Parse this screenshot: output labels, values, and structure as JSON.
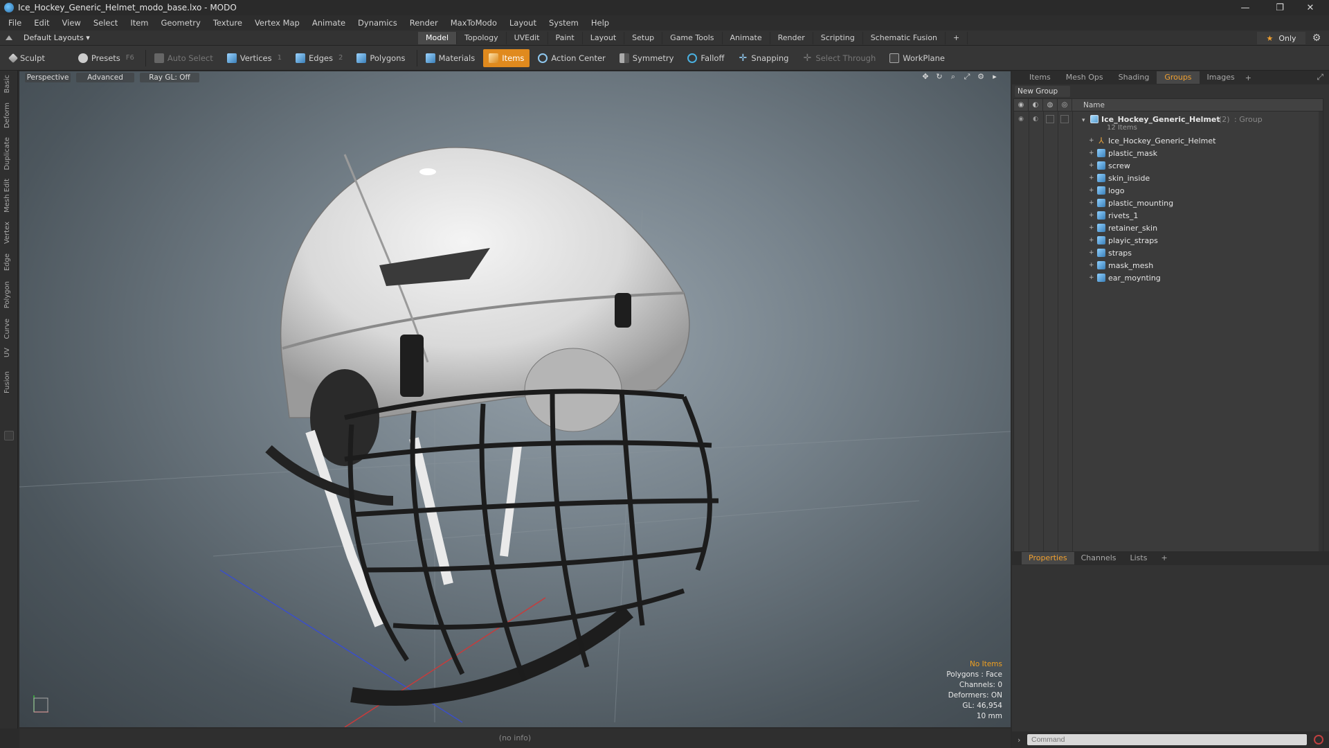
{
  "window": {
    "title": "Ice_Hockey_Generic_Helmet_modo_base.lxo - MODO",
    "controls": [
      "—",
      "❐",
      "✕"
    ]
  },
  "menu": [
    "File",
    "Edit",
    "View",
    "Select",
    "Item",
    "Geometry",
    "Texture",
    "Vertex Map",
    "Animate",
    "Dynamics",
    "Render",
    "MaxToModo",
    "Layout",
    "System",
    "Help"
  ],
  "layout": {
    "preset": "Default Layouts ▾",
    "tabs": [
      "Model",
      "Topology",
      "UVEdit",
      "Paint",
      "Layout",
      "Setup",
      "Game Tools",
      "Animate",
      "Render",
      "Scripting",
      "Schematic Fusion",
      "+"
    ],
    "active_tab": "Model",
    "only_label": "Only"
  },
  "toolbar": {
    "sculpt": "Sculpt",
    "presets": "Presets",
    "presets_key": "F6",
    "auto_select": "Auto Select",
    "vertices": "Vertices",
    "vertices_count": "1",
    "edges": "Edges",
    "edges_count": "2",
    "polygons": "Polygons",
    "materials": "Materials",
    "items": "Items",
    "action_center": "Action Center",
    "symmetry": "Symmetry",
    "falloff": "Falloff",
    "snapping": "Snapping",
    "select_through": "Select Through",
    "workplane": "WorkPlane"
  },
  "left_strip": [
    "Basic",
    "Deform",
    "Duplicate",
    "Mesh Edit",
    "Vertex",
    "Edge",
    "Polygon",
    "Curve",
    "UV",
    "Fusion"
  ],
  "viewport": {
    "perspective": "Perspective",
    "advanced": "Advanced",
    "raygl": "Ray GL: Off",
    "hud": {
      "no_items": "No Items",
      "polygons": "Polygons : Face",
      "channels": "Channels: 0",
      "deformers": "Deformers: ON",
      "gl": "GL: 46,954",
      "scale": "10 mm"
    }
  },
  "status": {
    "info": "(no info)"
  },
  "right_panel": {
    "tabs": [
      "Items",
      "Mesh Ops",
      "Shading",
      "Groups",
      "Images"
    ],
    "active_tab": "Groups",
    "plus": "+",
    "new_group": "New Group",
    "column_name": "Name",
    "group": {
      "name": "Ice_Hockey_Generic_Helmet",
      "count": "(2)",
      "type": ": Group",
      "items_count": "12 Items"
    },
    "items": [
      "Ice_Hockey_Generic_Helmet",
      "plastic_mask",
      "screw",
      "skin_inside",
      "logo",
      "plastic_mounting",
      "rivets_1",
      "retainer_skin",
      "playic_straps",
      "straps",
      "mask_mesh",
      "ear_moynting"
    ],
    "props_tabs": [
      "Properties",
      "Channels",
      "Lists",
      "+"
    ],
    "command_placeholder": "Command"
  }
}
